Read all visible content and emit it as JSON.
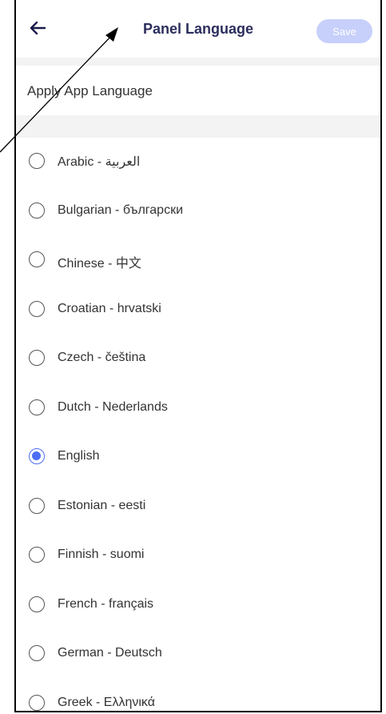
{
  "header": {
    "back_icon": "arrow-left-icon",
    "title": "Panel Language",
    "save_label": "Save"
  },
  "apply_app_language": "Apply App Language",
  "languages": [
    {
      "label": "Arabic - العربية",
      "selected": false
    },
    {
      "label": "Bulgarian - български",
      "selected": false
    },
    {
      "label": "Chinese - 中文",
      "selected": false
    },
    {
      "label": "Croatian - hrvatski",
      "selected": false
    },
    {
      "label": "Czech - čeština",
      "selected": false
    },
    {
      "label": "Dutch - Nederlands",
      "selected": false
    },
    {
      "label": "English",
      "selected": true
    },
    {
      "label": "Estonian - eesti",
      "selected": false
    },
    {
      "label": "Finnish - suomi",
      "selected": false
    },
    {
      "label": "French - français",
      "selected": false
    },
    {
      "label": "German - Deutsch",
      "selected": false
    },
    {
      "label": "Greek - Ελληνικά",
      "selected": false
    }
  ],
  "colors": {
    "accent": "#4c6ef5",
    "save_button_disabled": "#c7d0fb",
    "title": "#2b2e5c"
  }
}
